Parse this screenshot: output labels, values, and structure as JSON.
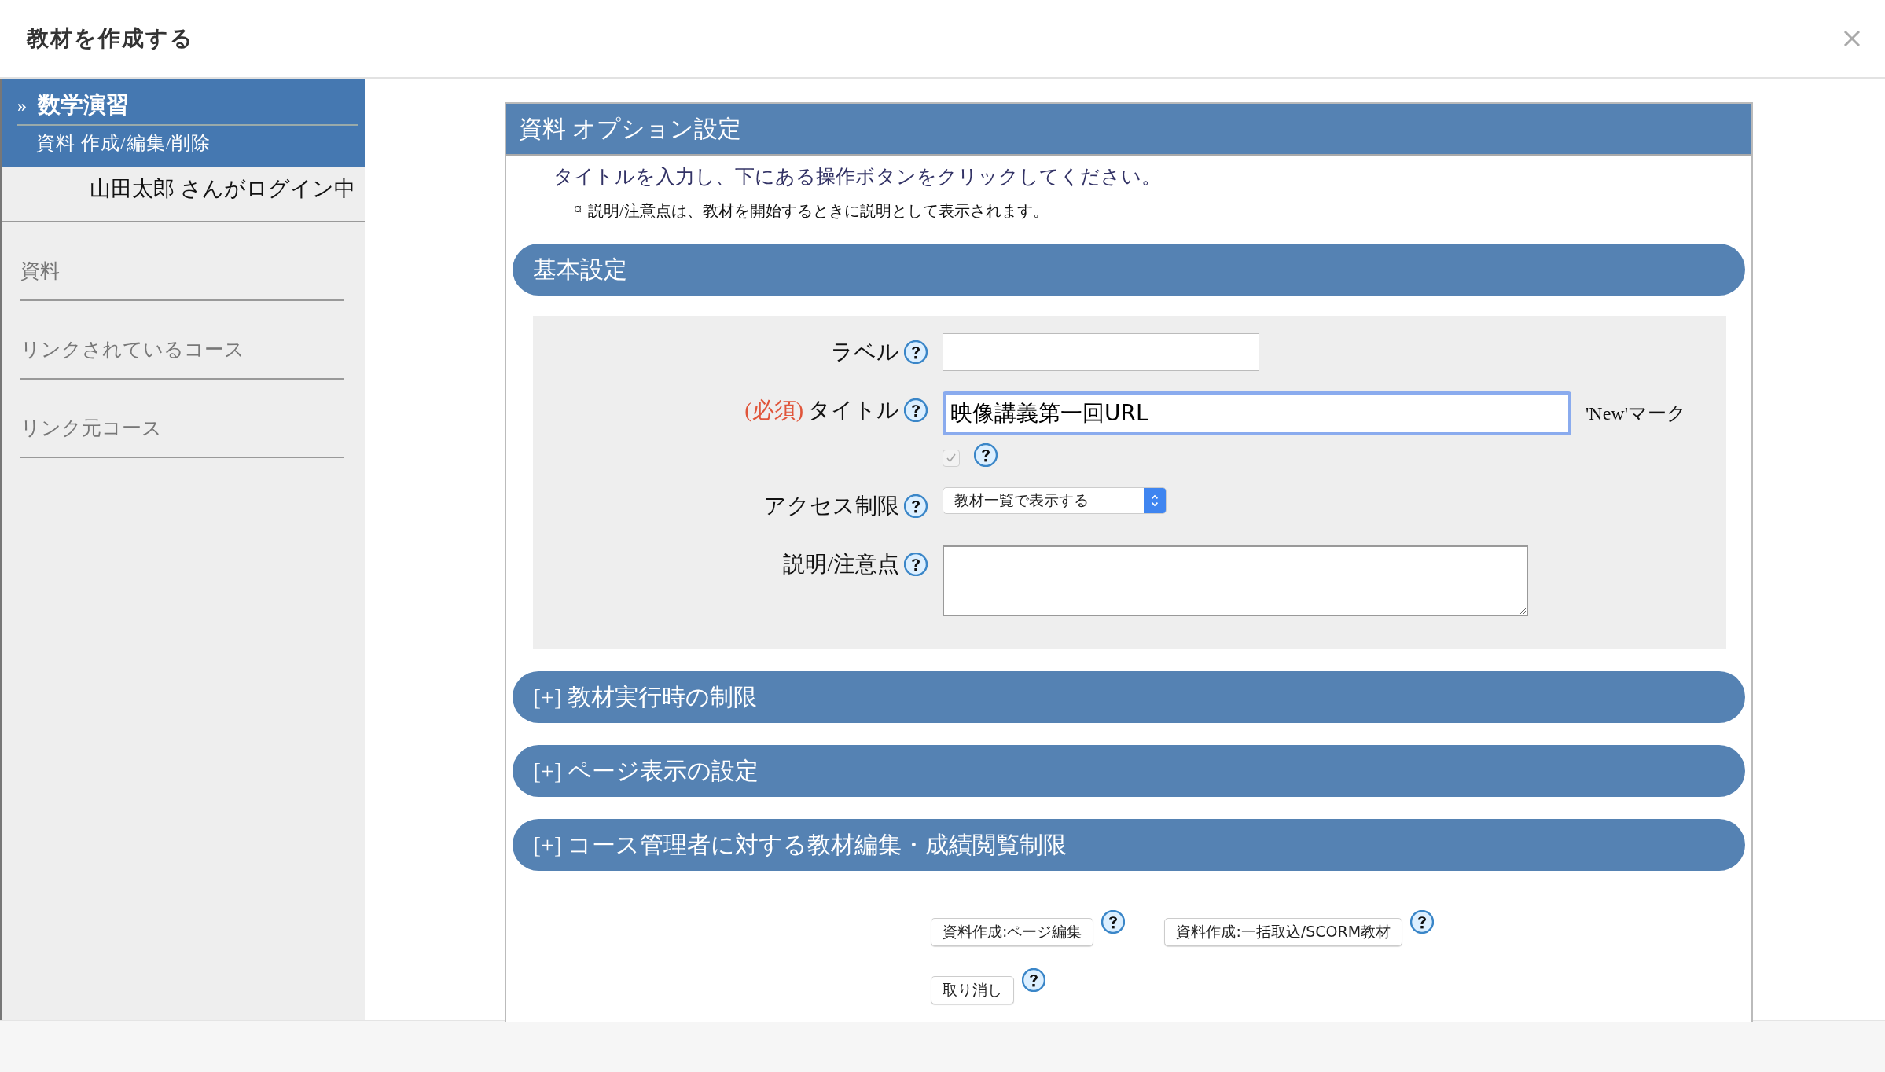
{
  "window": {
    "title": "教材を作成する"
  },
  "sidebar": {
    "marker": "»",
    "course": "数学演習",
    "subtitle": "資料 作成/編集/削除",
    "login_status": "山田太郎 さんがログイン中",
    "items": [
      {
        "label": "資料"
      },
      {
        "label": "リンクされているコース"
      },
      {
        "label": "リンク元コース"
      }
    ]
  },
  "panel": {
    "title": "資料 オプション設定",
    "instruction": "タイトルを入力し、下にある操作ボタンをクリックしてください。",
    "note_marker": "¤",
    "note": "説明/注意点は、教材を開始するときに説明として表示されます。",
    "sections": [
      {
        "title": "基本設定",
        "fields": [
          {
            "kind": "text",
            "label": "ラベル"
          },
          {
            "kind": "text",
            "required_mark": "(必須)",
            "label": "タイトル",
            "value": "映像講義第一回URL",
            "focused": true,
            "new_mark": {
              "label": "'New'マーク",
              "checked": true,
              "disabled": true
            }
          },
          {
            "kind": "select",
            "label": "アクセス制限",
            "value": "教材一覧で表示する"
          },
          {
            "kind": "textarea",
            "label": "説明/注意点"
          }
        ]
      },
      {
        "title": "[+] 教材実行時の制限"
      },
      {
        "title": "[+] ページ表示の設定"
      },
      {
        "title": "[+] コース管理者に対する教材編集・成績閲覧制限"
      }
    ],
    "button_rows": [
      [
        {
          "label": "資料作成:ページ編集"
        },
        {
          "label": "資料作成:一括取込/SCORM教材"
        }
      ],
      [
        {
          "label": "取り消し"
        }
      ]
    ]
  }
}
